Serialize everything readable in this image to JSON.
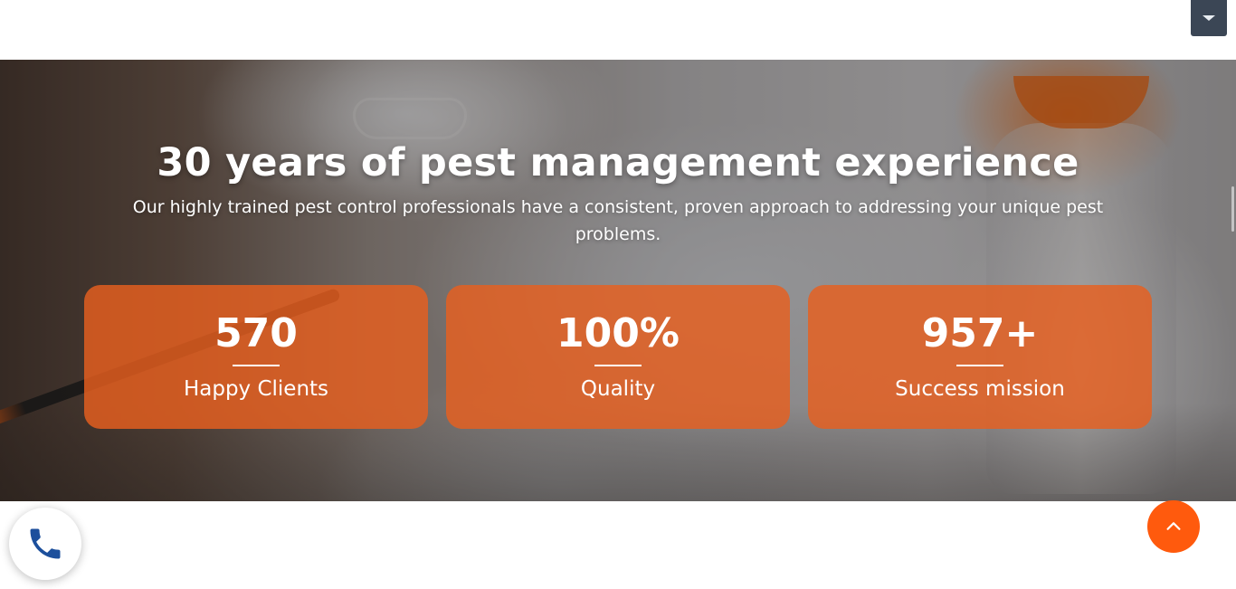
{
  "header": {
    "menu_toggle_icon": "chevron-down-icon"
  },
  "hero": {
    "title": "30 years of pest management experience",
    "subtitle": "Our highly trained pest control professionals have a consistent, proven approach to addressing your unique pest problems."
  },
  "stats": [
    {
      "value": "570",
      "label": "Happy Clients"
    },
    {
      "value": "100%",
      "label": "Quality"
    },
    {
      "value": "957+",
      "label": "Success mission"
    }
  ],
  "floating": {
    "call_icon": "phone-icon",
    "back_to_top_icon": "chevron-up-icon"
  },
  "colors": {
    "accent_orange": "#ff5a0d",
    "card_orange": "#e85f1e",
    "phone_blue": "#1c4f9c",
    "toggle_dark": "#3b4655"
  }
}
